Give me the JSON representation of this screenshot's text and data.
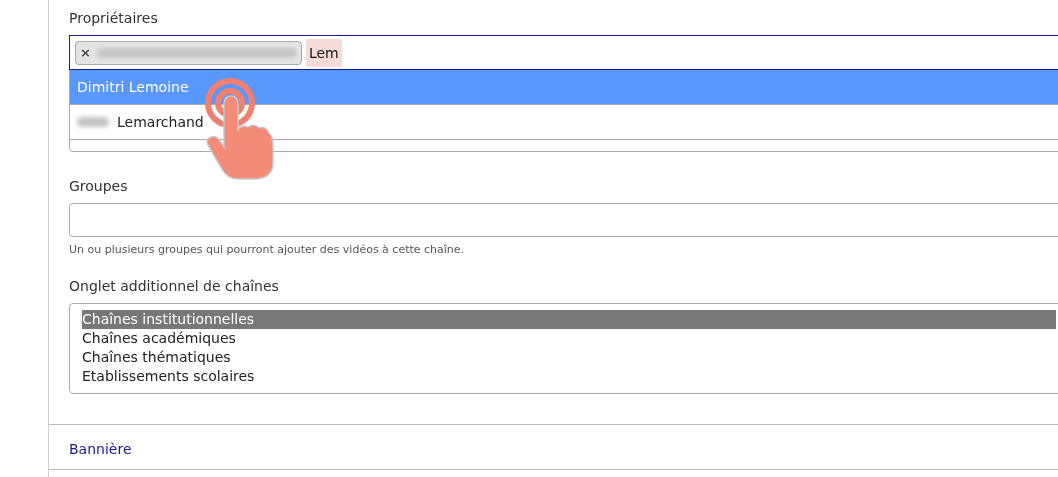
{
  "owners": {
    "label": "Propriétaires",
    "tags": [
      {
        "kind": "blurred",
        "remove": "×"
      }
    ],
    "query": "Lem",
    "suggestions": [
      {
        "blurred_prefix": false,
        "text": "Dimitri Lemoine",
        "selected": true
      },
      {
        "blurred_prefix": true,
        "text": "Lemarchand",
        "selected": false
      }
    ]
  },
  "groups": {
    "label": "Groupes",
    "help": "Un ou plusieurs groupes qui pourront ajouter des vidéos à cette chaîne."
  },
  "extra_tab": {
    "label": "Onglet additionnel de chaînes",
    "options": [
      {
        "label": "Chaînes institutionnelles",
        "selected": true
      },
      {
        "label": "Chaînes académiques",
        "selected": false
      },
      {
        "label": "Chaînes thématiques",
        "selected": false
      },
      {
        "label": "Etablissements scolaires",
        "selected": false
      }
    ]
  },
  "section_link": "Bannière",
  "pointer": {
    "kind": "tap"
  }
}
